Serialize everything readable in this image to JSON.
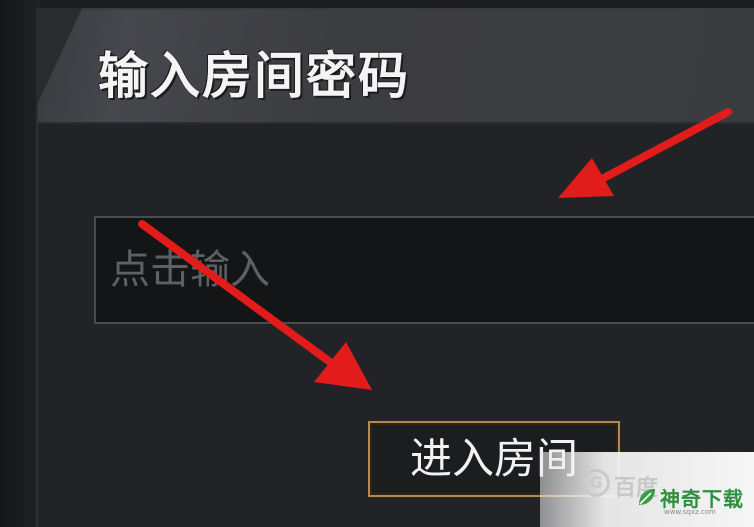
{
  "dialog": {
    "title": "输入房间密码",
    "password_placeholder": "点击输入",
    "enter_button_label": "进入房间"
  },
  "overlay": {
    "arrow_color": "#e21b1b",
    "watermarks": {
      "baidu_logo": "百度",
      "shenqi_text": "神奇下载",
      "shenqi_url": "www.sqxz.com",
      "shenqi_icon": "leaf-icon",
      "shenqi_color": "#2f8f3e"
    }
  },
  "colors": {
    "background": "#1b1c1e",
    "header": "#3c3d41",
    "field_border": "#4a4b4f",
    "button_border": "#b08a52"
  }
}
